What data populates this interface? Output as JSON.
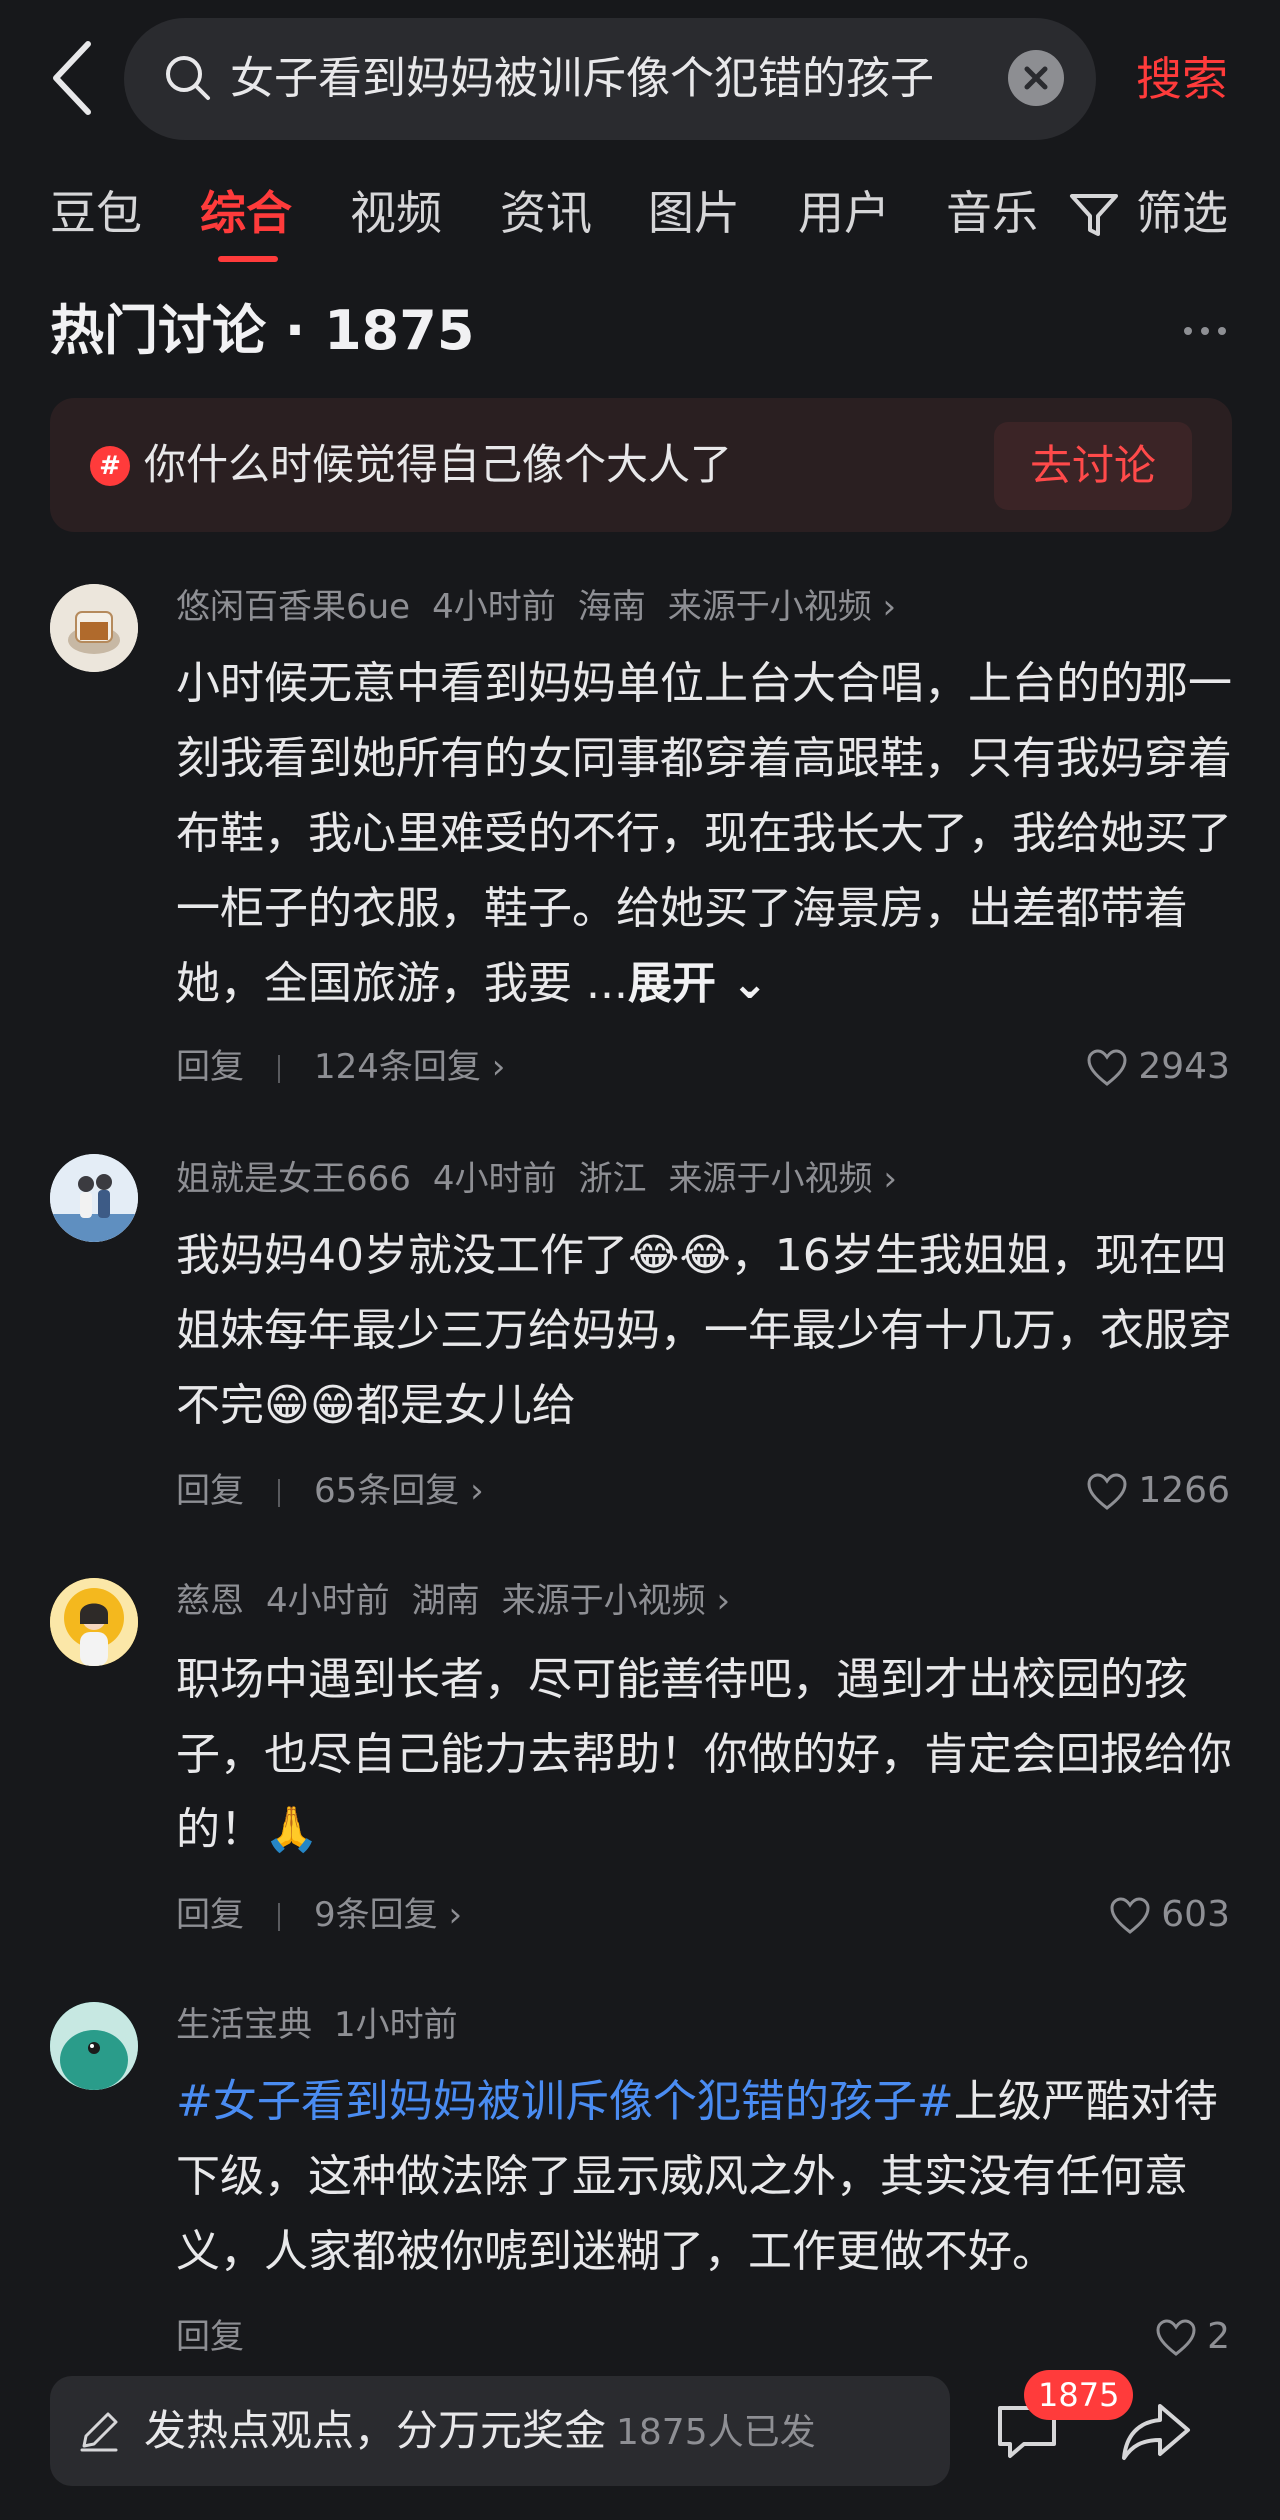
{
  "search": {
    "query": "女子看到妈妈被训斥像个犯错的孩子",
    "button_label": "搜索"
  },
  "tabs": [
    "豆包",
    "综合",
    "视频",
    "资讯",
    "图片",
    "用户",
    "音乐"
  ],
  "active_tab": "综合",
  "filter_label": "筛选",
  "section": {
    "title": "热门讨论 · 1875"
  },
  "topic": {
    "text": "你什么时候觉得自己像个大人了",
    "button_label": "去讨论"
  },
  "comments": [
    {
      "user": "悠闲百香果6ue",
      "time": "4小时前",
      "location": "海南",
      "source": "来源于小视频 ›",
      "content": "小时候无意中看到妈妈单位上台大合唱，上台的的那一刻我看到她所有的女同事都穿着高跟鞋，只有我妈穿着布鞋，我心里难受的不行，现在我长大了，我给她买了一柜子的衣服，鞋子。给她买了海景房，出差都带着她，全国旅游，我要 ...",
      "expand_label": "展开",
      "reply_label": "回复",
      "replies": "124条回复 ›",
      "likes": "2943"
    },
    {
      "user": "姐就是女王666",
      "time": "4小时前",
      "location": "浙江",
      "source": "来源于小视频 ›",
      "content": "我妈妈40岁就没工作了😂😂，16岁生我姐姐，现在四姐妹每年最少三万给妈妈，一年最少有十几万，衣服穿不完😁😁都是女儿给",
      "reply_label": "回复",
      "replies": "65条回复 ›",
      "likes": "1266"
    },
    {
      "user": "慈恩",
      "time": "4小时前",
      "location": "湖南",
      "source": "来源于小视频 ›",
      "content": "职场中遇到长者，尽可能善待吧，遇到才出校园的孩子，也尽自己能力去帮助！你做的好，肯定会回报给你的！🙏",
      "reply_label": "回复",
      "replies": "9条回复 ›",
      "likes": "603"
    },
    {
      "user": "生活宝典",
      "time": "1小时前",
      "hashtag": "#女子看到妈妈被训斥像个犯错的孩子#",
      "content": "上级严酷对待下级，这种做法除了显示威风之外，其实没有任何意义，人家都被你唬到迷糊了，工作更做不好。",
      "reply_label": "回复",
      "likes": "2"
    }
  ],
  "bottom_bar": {
    "input_text": "发热点观点，分万元奖金",
    "participants": "1875人已发",
    "comment_badge": "1875"
  },
  "colors": {
    "accent": "#ff3b3b",
    "hashtag": "#4a8cf2",
    "background": "#17181b"
  }
}
